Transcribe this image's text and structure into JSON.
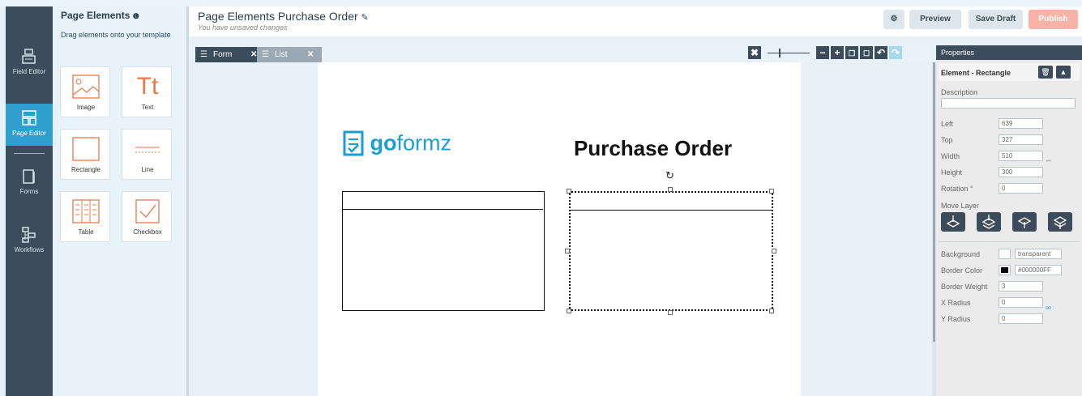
{
  "left_nav": {
    "items": [
      {
        "label": "Field Editor",
        "active": false
      },
      {
        "label": "Page Editor",
        "active": true
      },
      {
        "label": "Forms",
        "active": false
      },
      {
        "label": "Workflows",
        "active": false
      }
    ]
  },
  "elements_panel": {
    "title": "Page Elements",
    "subtitle": "Drag elements onto your template",
    "tiles": [
      "Image",
      "Text",
      "Rectangle",
      "Line",
      "Table",
      "Checkbox"
    ]
  },
  "header": {
    "title": "Page Elements Purchase Order",
    "status": "You have unsaved changes",
    "preview": "Preview",
    "save_draft": "Save Draft",
    "publish": "Publish"
  },
  "tabs": [
    {
      "label": "Form",
      "active": true
    },
    {
      "label": "List",
      "active": false
    }
  ],
  "canvas": {
    "logo_text_bold": "go",
    "logo_text_light": "formz",
    "heading": "Purchase Order",
    "logo_color": "#1a9ed6"
  },
  "properties": {
    "header": "Properties",
    "element_title": "Element - Rectangle",
    "description_label": "Description",
    "description_value": "",
    "left_label": "Left",
    "left_value": "639",
    "top_label": "Top",
    "top_value": "327",
    "width_label": "Width",
    "width_value": "510",
    "height_label": "Height",
    "height_value": "300",
    "rotation_label": "Rotation °",
    "rotation_value": "0",
    "move_layer_label": "Move Layer",
    "background_label": "Background",
    "background_value": "transparent",
    "border_color_label": "Border Color",
    "border_color_value": "#000000FF",
    "border_weight_label": "Border Weight",
    "border_weight_value": "3",
    "x_radius_label": "X Radius",
    "x_radius_value": "0",
    "y_radius_label": "Y Radius",
    "y_radius_value": "0"
  },
  "colors": {
    "accent": "#2f9fd0",
    "nav_bg": "#3c4c5a",
    "publish_bg": "#f8b3a6",
    "tile_icon": "#e8784a"
  }
}
